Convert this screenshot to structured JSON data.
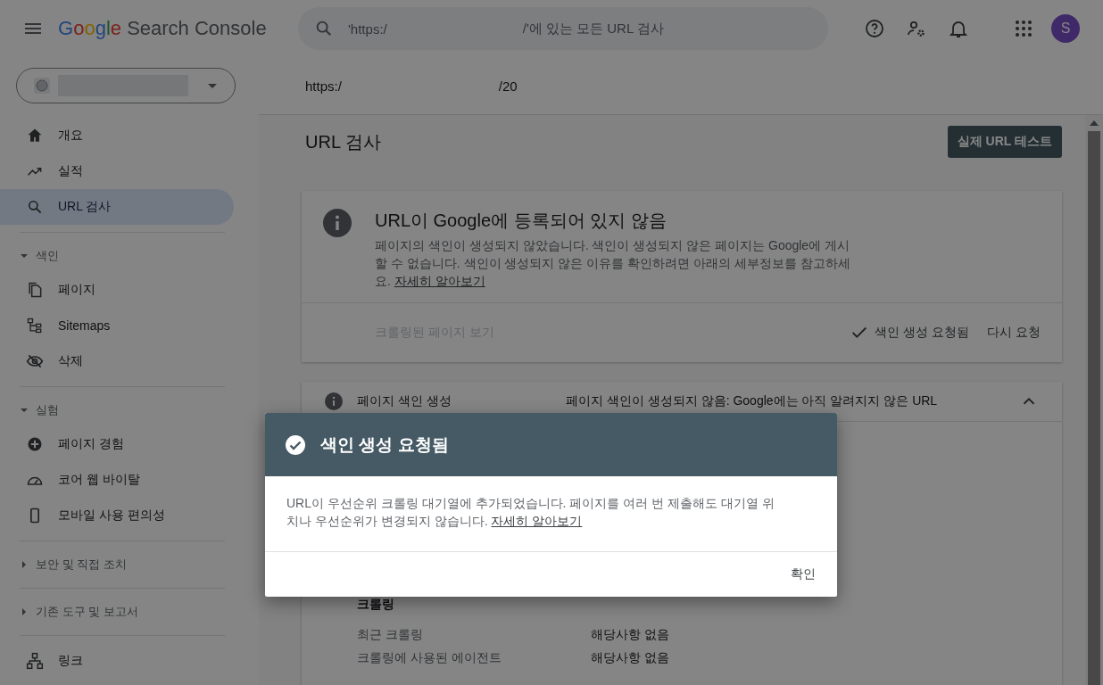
{
  "header": {
    "logo_word": "Google",
    "product": "Search Console",
    "search": {
      "text_start": "'https:/",
      "text_end": "/'에 있는 모든 URL 검사"
    },
    "avatar": "S"
  },
  "sidebar": {
    "groups": [
      {
        "items": [
          {
            "label": "개요",
            "selected": false
          },
          {
            "label": "실적",
            "selected": false
          },
          {
            "label": "URL 검사",
            "selected": true
          }
        ]
      },
      {
        "title": "색인",
        "expanded": true,
        "items": [
          {
            "label": "페이지",
            "selected": false
          },
          {
            "label": "Sitemaps",
            "selected": false
          },
          {
            "label": "삭제",
            "selected": false
          }
        ]
      },
      {
        "title": "실험",
        "expanded": true,
        "items": [
          {
            "label": "페이지 경험",
            "selected": false
          },
          {
            "label": "코어 웹 바이탈",
            "selected": false
          },
          {
            "label": "모바일 사용 편의성",
            "selected": false
          }
        ]
      },
      {
        "title": "보안 및 직접 조치",
        "expanded": false
      },
      {
        "title": "기존 도구 및 보고서",
        "expanded": false
      },
      {
        "items": [
          {
            "label": "링크",
            "selected": false
          }
        ]
      }
    ]
  },
  "url_bar": {
    "start": "https:/",
    "end": "/20"
  },
  "page_title": "URL 검사",
  "test_button": "실제 URL 테스트",
  "status_card": {
    "title": "URL이 Google에 등록되어 있지 않음",
    "description": "페이지의 색인이 생성되지 않았습니다. 색인이 생성되지 않은 페이지는 Google에 게시할 수 없습니다. 색인이 생성되지 않은 이유를 확인하려면 아래의 세부정보를 참고하세요.",
    "link": "자세히 알아보기",
    "view_crawled": {
      "label": "크롤링된 페이지 보기",
      "disabled": true
    },
    "request_status": "색인 생성 요청됨",
    "request_again": "다시 요청"
  },
  "coverage": {
    "label": "페이지 색인 생성",
    "status": "페이지 색인이 생성되지 않음: Google에는 아직 알려지지 않은 URL",
    "expanded": true,
    "section": "크롤링",
    "rows": [
      {
        "name": "최근 크롤링",
        "value": "해당사항 없음"
      },
      {
        "name": "크롤링에 사용된 에이전트",
        "value": "해당사항 없음"
      }
    ]
  },
  "dialog": {
    "title": "색인 생성 요청됨",
    "body": "URL이 우선순위 크롤링 대기열에 추가되었습니다. 페이지를 여러 번 제출해도 대기열 위치나 우선순위가 변경되지 않습니다.",
    "link": "자세히 알아보기",
    "button": "확인"
  }
}
